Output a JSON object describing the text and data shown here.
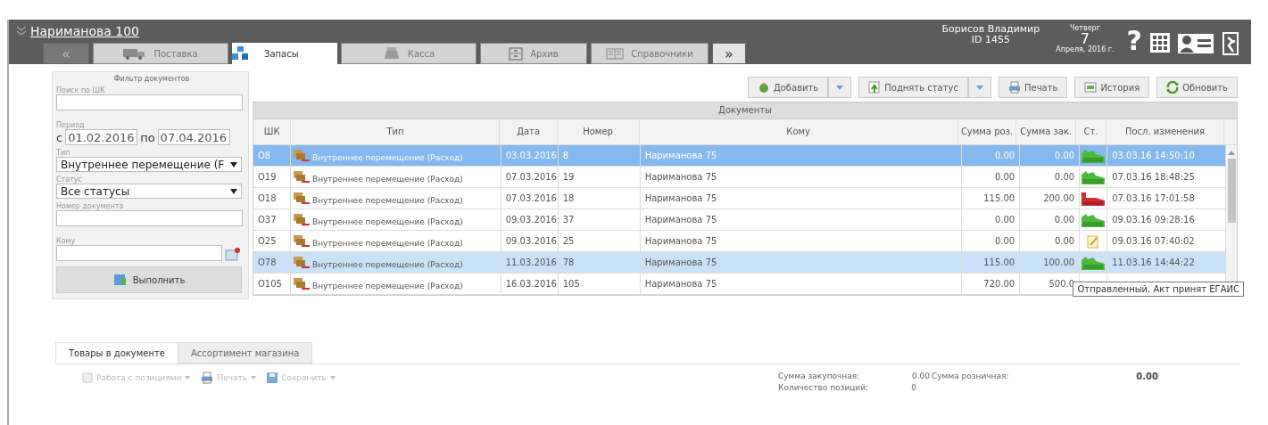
{
  "header": {
    "title": "Нариманова 100",
    "user": "Борисов Владимир",
    "user_id": "ID 1455",
    "weekday": "Четверг",
    "day": "7",
    "month_year": "Апреля, 2016 г.",
    "help": "?"
  },
  "nav_tabs": [
    {
      "label": "«",
      "kind": "arrow",
      "selected": false
    },
    {
      "label": "Поставка",
      "kind": "truck",
      "selected": false
    },
    {
      "label": "Запасы",
      "kind": "boxes",
      "selected": true
    },
    {
      "label": "Касса",
      "kind": "register",
      "selected": false
    },
    {
      "label": "Архив",
      "kind": "archive",
      "selected": false
    },
    {
      "label": "Справочники",
      "kind": "book",
      "selected": false
    },
    {
      "label": "»",
      "kind": "arrow",
      "selected": false
    }
  ],
  "filter": {
    "title": "Фильтр документов",
    "barcode_label": "Поиск по ШК",
    "period_label": "Период",
    "from_prefix": "с",
    "date_from": "01.02.2016",
    "to_prefix": "по",
    "date_to": "07.04.2016",
    "type_label": "Тип",
    "type_value": "Внутреннее перемещение (F",
    "status_label": "Статус",
    "status_value": "Все статусы",
    "number_label": "Номер документа",
    "to_label": "Кому",
    "run_button": "Выполнить"
  },
  "toolbar": [
    {
      "label": "Добавить",
      "kind": "add",
      "dropdown": true
    },
    {
      "label": "Поднять статус",
      "kind": "raise",
      "dropdown": true
    },
    {
      "label": "Печать",
      "kind": "print",
      "dropdown": false
    },
    {
      "label": "История",
      "kind": "history",
      "dropdown": false
    },
    {
      "label": "Обновить",
      "kind": "refresh",
      "dropdown": false
    }
  ],
  "table": {
    "caption": "Документы",
    "columns": [
      "ШК",
      "Тип",
      "Дата",
      "Номер",
      "Кому",
      "Сумма роз.",
      "Сумма зак.",
      "Ст.",
      "Посл. изменения"
    ],
    "rows": [
      {
        "code": "O8",
        "type": "Внутреннее перемещение (Расход)",
        "date": "03.03.2016",
        "number": "8",
        "to": "Нариманова 75",
        "sum_retail": "0.00",
        "sum_purchase": "0.00",
        "kind": "egais_ok",
        "changed": "03.03.16 14:50:10",
        "selected": true,
        "hovered": false
      },
      {
        "code": "O19",
        "type": "Внутреннее перемещение (Расход)",
        "date": "07.03.2016",
        "number": "19",
        "to": "Нариманова 75",
        "sum_retail": "0.00",
        "sum_purchase": "0.00",
        "kind": "egais_ok",
        "changed": "07.03.16 18:48:25",
        "selected": false,
        "hovered": false
      },
      {
        "code": "O18",
        "type": "Внутреннее перемещение (Расход)",
        "date": "07.03.2016",
        "number": "18",
        "to": "Нариманова 75",
        "sum_retail": "115.00",
        "sum_purchase": "200.00",
        "kind": "egais_error",
        "changed": "07.03.16 17:01:58",
        "selected": false,
        "hovered": false
      },
      {
        "code": "O37",
        "type": "Внутреннее перемещение (Расход)",
        "date": "09.03.2016",
        "number": "37",
        "to": "Нариманова 75",
        "sum_retail": "0.00",
        "sum_purchase": "0.00",
        "kind": "egais_ok",
        "changed": "09.03.16 09:28:16",
        "selected": false,
        "hovered": false
      },
      {
        "code": "O25",
        "type": "Внутреннее перемещение (Расход)",
        "date": "09.03.2016",
        "number": "25",
        "to": "Нариманова 75",
        "sum_retail": "0.00",
        "sum_purchase": "0.00",
        "kind": "draft",
        "changed": "09.03.16 07:40:02",
        "selected": false,
        "hovered": false
      },
      {
        "code": "O78",
        "type": "Внутреннее перемещение (Расход)",
        "date": "11.03.2016",
        "number": "78",
        "to": "Нариманова 75",
        "sum_retail": "115.00",
        "sum_purchase": "100.00",
        "kind": "egais_ok",
        "changed": "11.03.16 14:44:22",
        "selected": false,
        "hovered": true
      },
      {
        "code": "O105",
        "type": "Внутреннее перемещение (Расход)",
        "date": "16.03.2016",
        "number": "105",
        "to": "Нариманова 75",
        "sum_retail": "720.00",
        "sum_purchase": "500.0",
        "selected": false,
        "hovered": false
      }
    ]
  },
  "tooltip": "Отправленный. Акт принят ЕГАИС",
  "bottom_tabs": [
    {
      "label": "Товары в документе",
      "selected": true
    },
    {
      "label": "Ассортимент магазина",
      "selected": false
    }
  ],
  "bottom_toolbar": [
    {
      "label": "Работа с позициями",
      "kind": "positions"
    },
    {
      "label": "Печать",
      "kind": "print"
    },
    {
      "label": "Сохранить",
      "kind": "save"
    }
  ],
  "summary": {
    "purchase_label": "Сумма закупочная:",
    "purchase_value": "0.00",
    "retail_label": "Сумма розничная:",
    "retail_value": "0.00",
    "count_label": "Количество позиций:",
    "count_value": "0"
  }
}
